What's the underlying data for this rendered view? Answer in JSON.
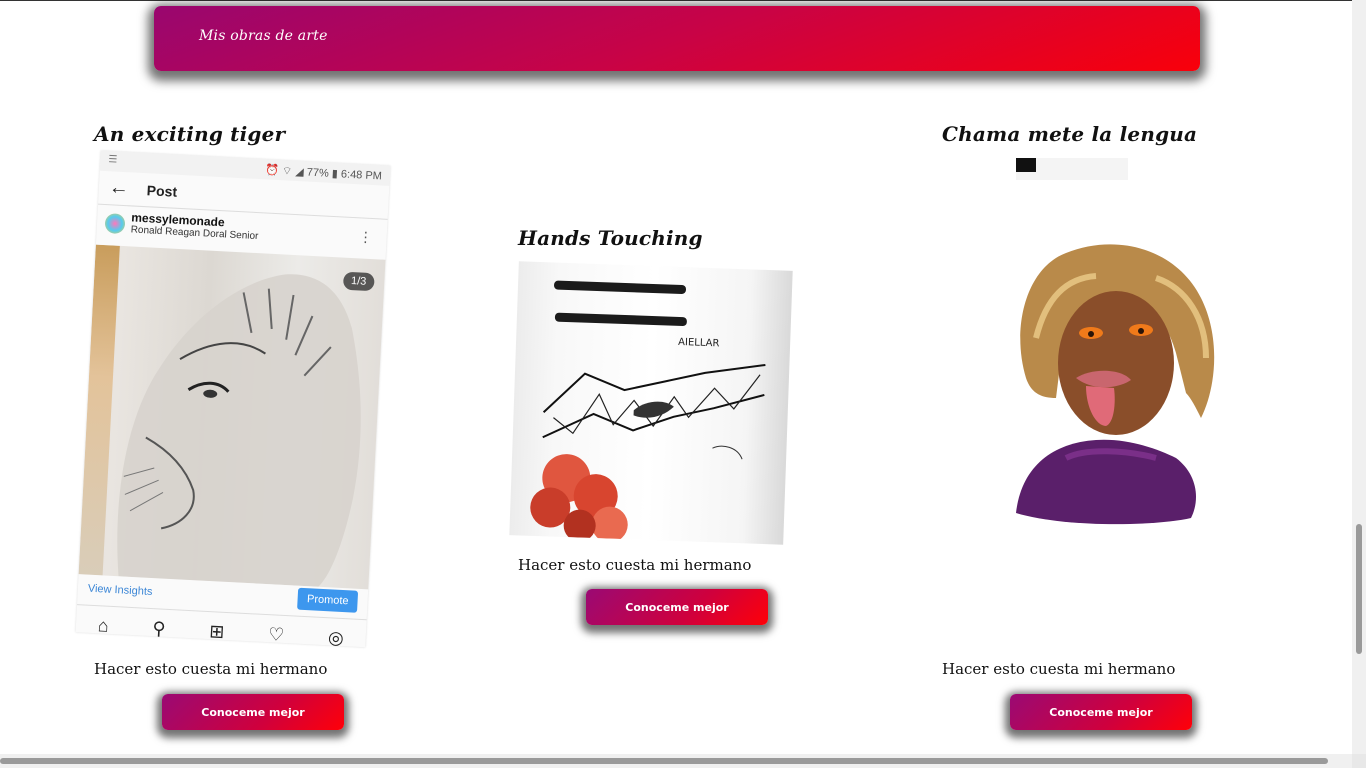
{
  "header": {
    "title": "Mis obras de arte"
  },
  "cards": [
    {
      "title": "An exciting tiger",
      "caption": "Hacer esto cuesta mi hermano",
      "button_label": "Conoceme mejor",
      "image": {
        "status_icons": "☰",
        "status_text": "⏰ ⌔ ◢ 77% ▮ 6:48 PM",
        "nav_title": "Post",
        "username": "messylemonade",
        "location": "Ronald Reagan Doral Senior",
        "counter": "1/3",
        "view_insights": "View Insights",
        "promote": "Promote"
      }
    },
    {
      "title": "Hands Touching",
      "caption": "Hacer esto cuesta mi hermano",
      "button_label": "Conoceme mejor",
      "image": {
        "signature": "AIELLAR"
      }
    },
    {
      "title": "Chama mete la lengua",
      "caption": "Hacer esto cuesta mi hermano",
      "button_label": "Conoceme mejor"
    }
  ],
  "colors": {
    "gradient_start": "#99066f",
    "gradient_end": "#f9000a"
  },
  "icons": [
    "back-arrow-icon",
    "home-icon",
    "search-icon",
    "add-icon",
    "heart-icon",
    "profile-icon",
    "more-icon"
  ]
}
